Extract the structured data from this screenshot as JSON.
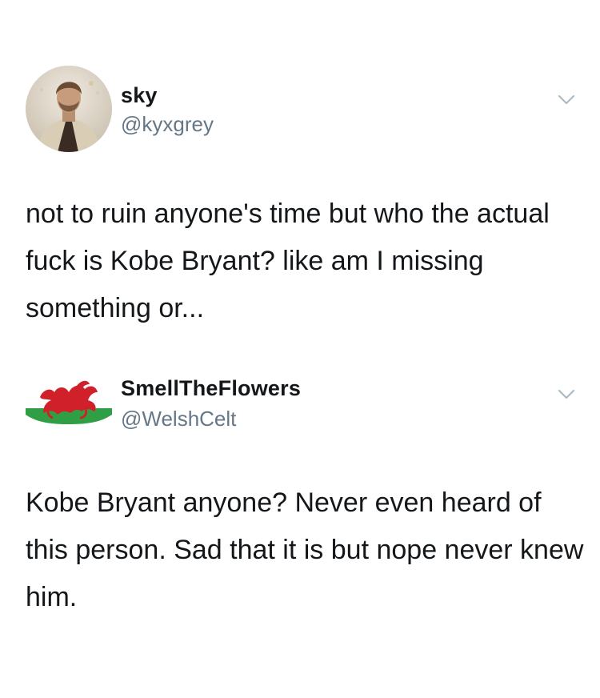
{
  "tweets": [
    {
      "display_name": "sky",
      "handle": "@kyxgrey",
      "avatar_icon": "profile-photo-avatar",
      "menu_icon": "chevron-down-icon",
      "text": "not to ruin anyone's time but who the actual fuck is Kobe Bryant? like am I missing something or..."
    },
    {
      "display_name": "SmellTheFlowers",
      "handle": "@WelshCelt",
      "avatar_icon": "welsh-flag-avatar",
      "menu_icon": "chevron-down-icon",
      "text": "Kobe Bryant anyone? Never even heard of this person. Sad that it is but nope never knew him."
    }
  ],
  "colors": {
    "text_primary": "#14171a",
    "text_secondary": "#657786",
    "chevron": "#aab8c2",
    "flag_green": "#2f9e45",
    "flag_red": "#d0202a"
  }
}
